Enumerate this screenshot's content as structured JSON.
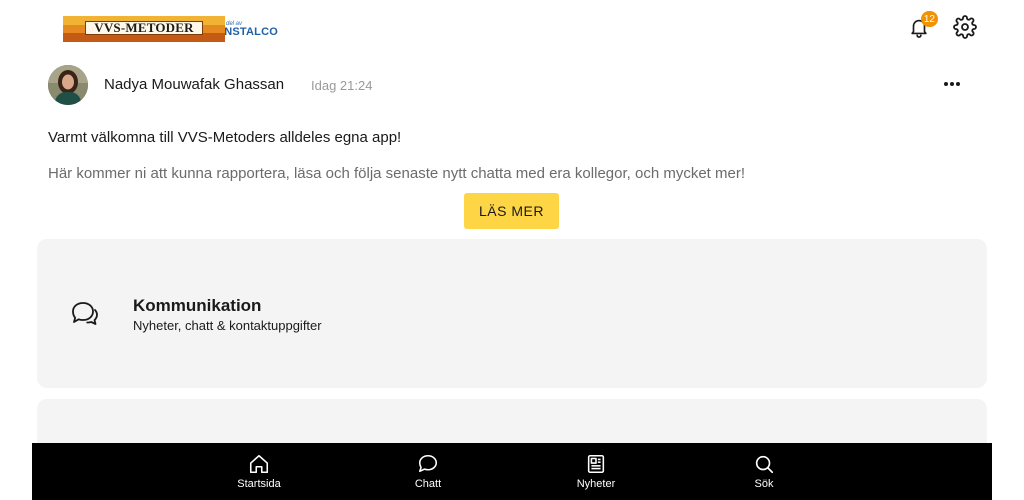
{
  "header": {
    "logo_text": "VVS-METODER",
    "logo_partner_prefix": "– del av",
    "logo_partner": "INSTALCO",
    "notification_count": "12",
    "icons": [
      "bell-icon",
      "gear-icon"
    ]
  },
  "post": {
    "author": "Nadya Mouwafak Ghassan",
    "time": "Idag 21:24",
    "title": "Varmt välkomna till VVS-Metoders alldeles egna app!",
    "body": "Här kommer ni att kunna rapportera, läsa och följa senaste nytt chatta med era kollegor, och mycket mer!",
    "read_more_label": "LÄS MER"
  },
  "cards": [
    {
      "title": "Kommunikation",
      "subtitle": "Nyheter, chatt & kontaktuppgifter",
      "icon": "chat-bubbles-icon"
    }
  ],
  "bottom_nav": [
    {
      "label": "Startsida",
      "icon": "home-icon"
    },
    {
      "label": "Chatt",
      "icon": "chat-icon"
    },
    {
      "label": "Nyheter",
      "icon": "news-icon"
    },
    {
      "label": "Sök",
      "icon": "search-icon"
    }
  ],
  "colors": {
    "accent": "#fed544",
    "badge": "#f39200",
    "card_bg": "#f4f4f5",
    "nav_bg": "#000000"
  }
}
